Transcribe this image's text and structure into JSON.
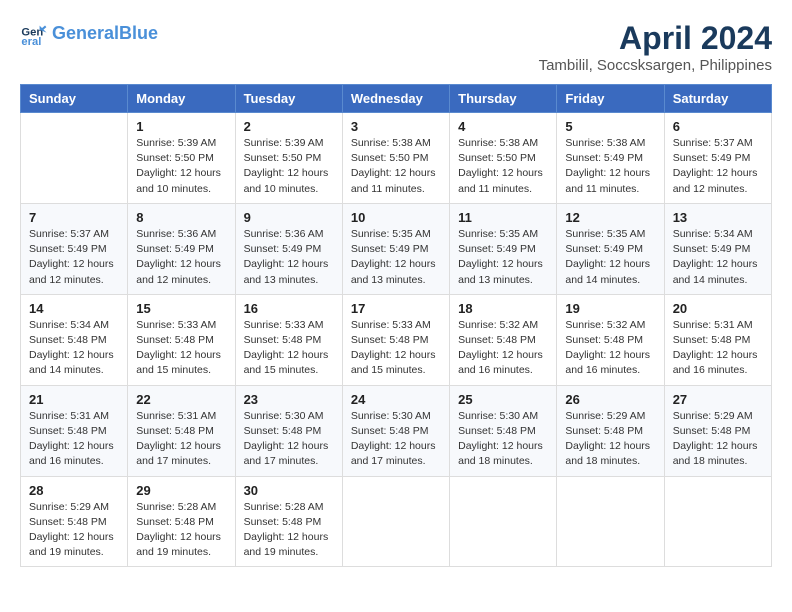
{
  "logo": {
    "line1": "General",
    "line2": "Blue"
  },
  "title": "April 2024",
  "subtitle": "Tambilil, Soccsksargen, Philippines",
  "days_of_week": [
    "Sunday",
    "Monday",
    "Tuesday",
    "Wednesday",
    "Thursday",
    "Friday",
    "Saturday"
  ],
  "weeks": [
    [
      {
        "day": "",
        "info": ""
      },
      {
        "day": "1",
        "info": "Sunrise: 5:39 AM\nSunset: 5:50 PM\nDaylight: 12 hours\nand 10 minutes."
      },
      {
        "day": "2",
        "info": "Sunrise: 5:39 AM\nSunset: 5:50 PM\nDaylight: 12 hours\nand 10 minutes."
      },
      {
        "day": "3",
        "info": "Sunrise: 5:38 AM\nSunset: 5:50 PM\nDaylight: 12 hours\nand 11 minutes."
      },
      {
        "day": "4",
        "info": "Sunrise: 5:38 AM\nSunset: 5:50 PM\nDaylight: 12 hours\nand 11 minutes."
      },
      {
        "day": "5",
        "info": "Sunrise: 5:38 AM\nSunset: 5:49 PM\nDaylight: 12 hours\nand 11 minutes."
      },
      {
        "day": "6",
        "info": "Sunrise: 5:37 AM\nSunset: 5:49 PM\nDaylight: 12 hours\nand 12 minutes."
      }
    ],
    [
      {
        "day": "7",
        "info": "Sunrise: 5:37 AM\nSunset: 5:49 PM\nDaylight: 12 hours\nand 12 minutes."
      },
      {
        "day": "8",
        "info": "Sunrise: 5:36 AM\nSunset: 5:49 PM\nDaylight: 12 hours\nand 12 minutes."
      },
      {
        "day": "9",
        "info": "Sunrise: 5:36 AM\nSunset: 5:49 PM\nDaylight: 12 hours\nand 13 minutes."
      },
      {
        "day": "10",
        "info": "Sunrise: 5:35 AM\nSunset: 5:49 PM\nDaylight: 12 hours\nand 13 minutes."
      },
      {
        "day": "11",
        "info": "Sunrise: 5:35 AM\nSunset: 5:49 PM\nDaylight: 12 hours\nand 13 minutes."
      },
      {
        "day": "12",
        "info": "Sunrise: 5:35 AM\nSunset: 5:49 PM\nDaylight: 12 hours\nand 14 minutes."
      },
      {
        "day": "13",
        "info": "Sunrise: 5:34 AM\nSunset: 5:49 PM\nDaylight: 12 hours\nand 14 minutes."
      }
    ],
    [
      {
        "day": "14",
        "info": "Sunrise: 5:34 AM\nSunset: 5:48 PM\nDaylight: 12 hours\nand 14 minutes."
      },
      {
        "day": "15",
        "info": "Sunrise: 5:33 AM\nSunset: 5:48 PM\nDaylight: 12 hours\nand 15 minutes."
      },
      {
        "day": "16",
        "info": "Sunrise: 5:33 AM\nSunset: 5:48 PM\nDaylight: 12 hours\nand 15 minutes."
      },
      {
        "day": "17",
        "info": "Sunrise: 5:33 AM\nSunset: 5:48 PM\nDaylight: 12 hours\nand 15 minutes."
      },
      {
        "day": "18",
        "info": "Sunrise: 5:32 AM\nSunset: 5:48 PM\nDaylight: 12 hours\nand 16 minutes."
      },
      {
        "day": "19",
        "info": "Sunrise: 5:32 AM\nSunset: 5:48 PM\nDaylight: 12 hours\nand 16 minutes."
      },
      {
        "day": "20",
        "info": "Sunrise: 5:31 AM\nSunset: 5:48 PM\nDaylight: 12 hours\nand 16 minutes."
      }
    ],
    [
      {
        "day": "21",
        "info": "Sunrise: 5:31 AM\nSunset: 5:48 PM\nDaylight: 12 hours\nand 16 minutes."
      },
      {
        "day": "22",
        "info": "Sunrise: 5:31 AM\nSunset: 5:48 PM\nDaylight: 12 hours\nand 17 minutes."
      },
      {
        "day": "23",
        "info": "Sunrise: 5:30 AM\nSunset: 5:48 PM\nDaylight: 12 hours\nand 17 minutes."
      },
      {
        "day": "24",
        "info": "Sunrise: 5:30 AM\nSunset: 5:48 PM\nDaylight: 12 hours\nand 17 minutes."
      },
      {
        "day": "25",
        "info": "Sunrise: 5:30 AM\nSunset: 5:48 PM\nDaylight: 12 hours\nand 18 minutes."
      },
      {
        "day": "26",
        "info": "Sunrise: 5:29 AM\nSunset: 5:48 PM\nDaylight: 12 hours\nand 18 minutes."
      },
      {
        "day": "27",
        "info": "Sunrise: 5:29 AM\nSunset: 5:48 PM\nDaylight: 12 hours\nand 18 minutes."
      }
    ],
    [
      {
        "day": "28",
        "info": "Sunrise: 5:29 AM\nSunset: 5:48 PM\nDaylight: 12 hours\nand 19 minutes."
      },
      {
        "day": "29",
        "info": "Sunrise: 5:28 AM\nSunset: 5:48 PM\nDaylight: 12 hours\nand 19 minutes."
      },
      {
        "day": "30",
        "info": "Sunrise: 5:28 AM\nSunset: 5:48 PM\nDaylight: 12 hours\nand 19 minutes."
      },
      {
        "day": "",
        "info": ""
      },
      {
        "day": "",
        "info": ""
      },
      {
        "day": "",
        "info": ""
      },
      {
        "day": "",
        "info": ""
      }
    ]
  ]
}
